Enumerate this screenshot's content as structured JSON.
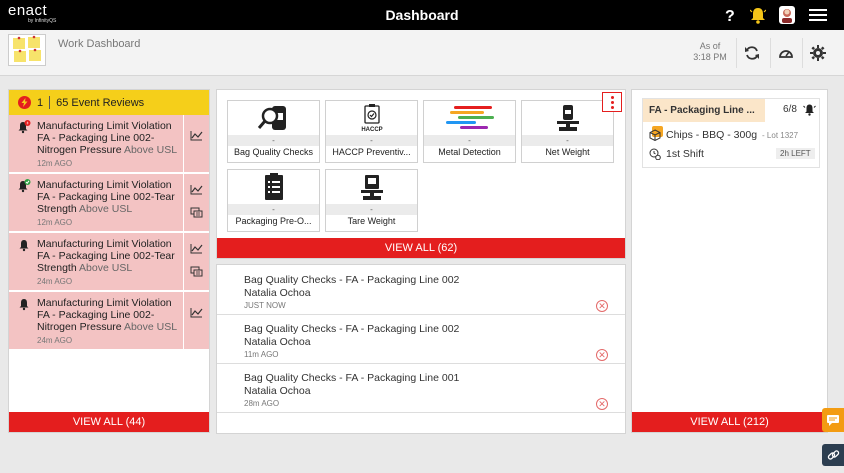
{
  "topbar": {
    "brand": "enact",
    "brand_sub": "by InfinityQS",
    "title": "Dashboard",
    "help_icon": "help-icon",
    "notifications_icon": "bell-notification-icon",
    "avatar_icon": "user-avatar",
    "menu_icon": "hamburger-menu-icon"
  },
  "subheader": {
    "title": "Work Dashboard",
    "as_of_label": "As of",
    "as_of_time": "3:18 PM"
  },
  "events": {
    "count": "1",
    "reviews_label": "65 Event Reviews",
    "items": [
      {
        "icon": "alert-bell-icon",
        "title": "Manufacturing Limit Violation",
        "line": "FA - Packaging Line 002-",
        "detail": "Nitrogen Pressure",
        "suffix": "Above USL",
        "time": "12m AGO"
      },
      {
        "icon": "acknowledged-bell-icon",
        "title": "Manufacturing Limit Violation",
        "line": "FA - Packaging Line 002-Tear",
        "detail": "Strength",
        "suffix": "Above USL",
        "time": "12m AGO"
      },
      {
        "icon": "bell-icon",
        "title": "Manufacturing Limit Violation",
        "line": "FA - Packaging Line 002-Tear",
        "detail": "Strength",
        "suffix": "Above USL",
        "time": "24m AGO"
      },
      {
        "icon": "bell-icon",
        "title": "Manufacturing Limit Violation",
        "line": "FA - Packaging Line 002-",
        "detail": "Nitrogen Pressure",
        "suffix": "Above USL",
        "time": "24m AGO"
      }
    ],
    "view_all": "VIEW ALL (44)"
  },
  "checks": {
    "tiles": [
      {
        "label": "Bag Quality Checks",
        "value": "-",
        "icon": "bag-magnifier-icon"
      },
      {
        "label": "HACCP Preventiv...",
        "value": "-",
        "icon": "haccp-clipboard-icon"
      },
      {
        "label": "Metal Detection",
        "value": "-",
        "icon": "metal-detection-bars-icon"
      },
      {
        "label": "Net Weight",
        "value": "-",
        "icon": "scale-bag-icon"
      },
      {
        "label": "Packaging Pre-O...",
        "value": "-",
        "icon": "checklist-clipboard-icon"
      },
      {
        "label": "Tare Weight",
        "value": "-",
        "icon": "tare-scale-icon"
      }
    ],
    "view_all": "VIEW ALL (62)"
  },
  "activity": {
    "items": [
      {
        "title": "Bag Quality Checks - FA - Packaging Line 002",
        "user": "Natalia Ochoa",
        "time": "JUST NOW"
      },
      {
        "title": "Bag Quality Checks - FA - Packaging Line 002",
        "user": "Natalia Ochoa",
        "time": "11m AGO"
      },
      {
        "title": "Bag Quality Checks - FA - Packaging Line 001",
        "user": "Natalia Ochoa",
        "time": "28m AGO"
      }
    ]
  },
  "lines": {
    "card": {
      "name": "FA - Packaging Line ...",
      "count": "6/8",
      "product": "Chips - BBQ - 300g",
      "lot": "- Lot 1327",
      "shift": "1st Shift",
      "shift_left": "2h LEFT"
    },
    "view_all": "VIEW ALL (212)"
  },
  "colors": {
    "accent_red": "#e41e1e",
    "event_yellow": "#f5cf1a",
    "event_pink": "#f3c3c3"
  }
}
